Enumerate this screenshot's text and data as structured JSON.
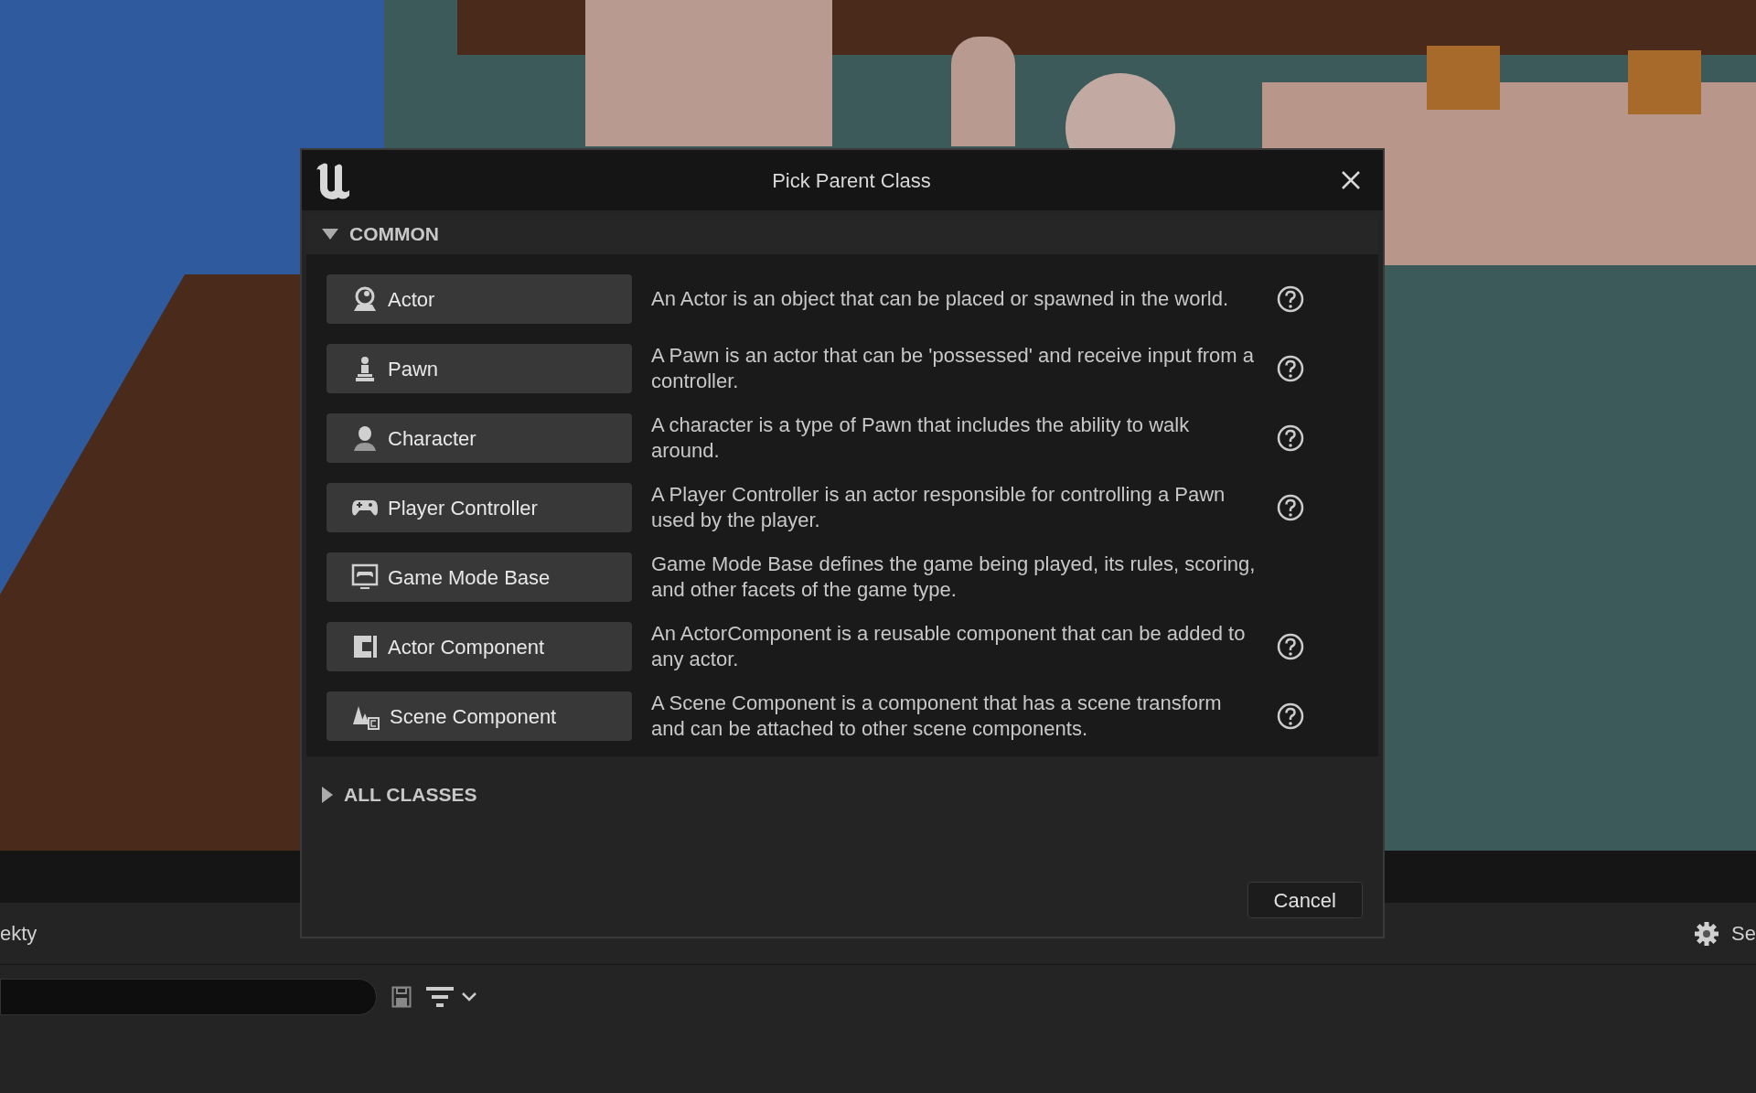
{
  "editor": {
    "panel_tab": "ekty",
    "settings_label": "Se"
  },
  "dialog": {
    "title": "Pick Parent Class",
    "sections": [
      {
        "title": "COMMON",
        "expanded": true,
        "classes": [
          {
            "kind": "actor",
            "label": "Actor",
            "description": "An Actor is an object that can be placed or spawned in the world.",
            "help": true
          },
          {
            "kind": "pawn",
            "label": "Pawn",
            "description": "A Pawn is an actor that can be 'possessed' and receive input from a controller.",
            "help": true
          },
          {
            "kind": "character",
            "label": "Character",
            "description": "A character is a type of Pawn that includes the ability to walk around.",
            "help": true
          },
          {
            "kind": "controller",
            "label": "Player Controller",
            "description": "A Player Controller is an actor responsible for controlling a Pawn used by the player.",
            "help": true
          },
          {
            "kind": "gamemode",
            "label": "Game Mode Base",
            "description": "Game Mode Base defines the game being played, its rules, scoring, and other facets of the game type.",
            "help": false
          },
          {
            "kind": "component",
            "label": "Actor Component",
            "description": "An ActorComponent is a reusable component that can be added to any actor.",
            "help": true
          },
          {
            "kind": "scene",
            "label": "Scene Component",
            "description": "A Scene Component is a component that has a scene transform and can be attached to other scene components.",
            "help": true
          }
        ]
      },
      {
        "title": "ALL CLASSES",
        "expanded": false
      }
    ],
    "cancel": "Cancel"
  }
}
